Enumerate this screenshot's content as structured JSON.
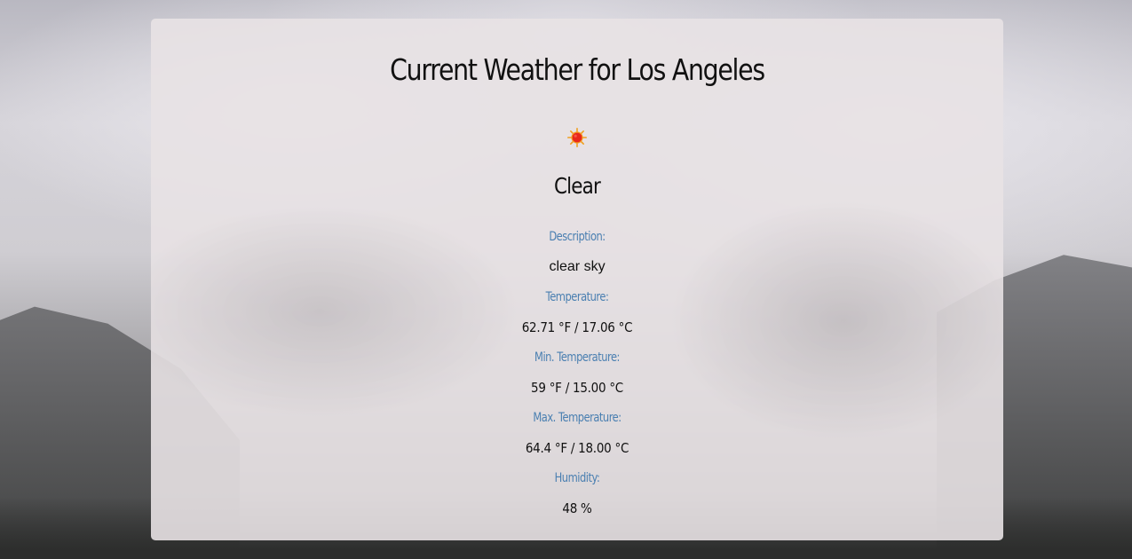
{
  "title": "Current Weather for Los Angeles",
  "icon": "clear-sun-icon",
  "condition": "Clear",
  "details": {
    "description_label": "Description:",
    "description_value": "clear sky",
    "temperature_label": "Temperature:",
    "temperature_value": "62.71 °F / 17.06 °C",
    "min_temperature_label": "Min. Temperature:",
    "min_temperature_value": "59 °F / 15.00 °C",
    "max_temperature_label": "Max. Temperature:",
    "max_temperature_value": "64.4 °F / 18.00 °C",
    "humidity_label": "Humidity:",
    "humidity_value": "48 %"
  },
  "colors": {
    "label": "#4a7fb1",
    "text": "#111111",
    "card": "#e8e2e4"
  }
}
